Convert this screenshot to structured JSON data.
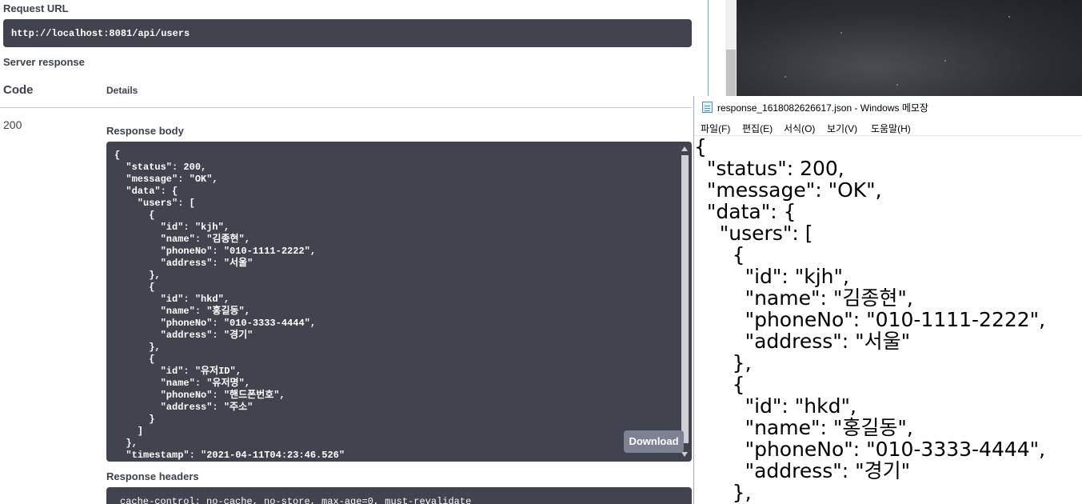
{
  "swagger": {
    "request_url_label": "Request URL",
    "request_url": "http://localhost:8081/api/users",
    "server_response_label": "Server response",
    "code_header": "Code",
    "details_header": "Details",
    "status_code": "200",
    "response_body_label": "Response body",
    "response_body_text": "{\n  \"status\": 200,\n  \"message\": \"OK\",\n  \"data\": {\n    \"users\": [\n      {\n        \"id\": \"kjh\",\n        \"name\": \"김종현\",\n        \"phoneNo\": \"010-1111-2222\",\n        \"address\": \"서울\"\n      },\n      {\n        \"id\": \"hkd\",\n        \"name\": \"홍길동\",\n        \"phoneNo\": \"010-3333-4444\",\n        \"address\": \"경기\"\n      },\n      {\n        \"id\": \"유저ID\",\n        \"name\": \"유저명\",\n        \"phoneNo\": \"핸드폰번호\",\n        \"address\": \"주소\"\n      }\n    ]\n  },\n  \"timestamp\": \"2021-04-11T04:23:46.526\"",
    "download_label": "Download",
    "response_headers_label": "Response headers",
    "response_headers_text": "cache-control: no-cache, no-store, max-age=0, must-revalidate"
  },
  "notepad": {
    "title": "response_1618082626617.json - Windows 메모장",
    "menu": [
      "파일(F)",
      "편집(E)",
      "서식(O)",
      "보기(V)",
      "도움말(H)"
    ],
    "content": "{\n  \"status\": 200,\n  \"message\": \"OK\",\n  \"data\": {\n    \"users\": [\n      {\n        \"id\": \"kjh\",\n        \"name\": \"김종현\",\n        \"phoneNo\": \"010-1111-2222\",\n        \"address\": \"서울\"\n      },\n      {\n        \"id\": \"hkd\",\n        \"name\": \"홍길동\",\n        \"phoneNo\": \"010-3333-4444\",\n        \"address\": \"경기\"\n      },"
  },
  "colors": {
    "code_block_bg": "#41444e",
    "download_button_bg": "#7d8293",
    "accent_line": "#61affe",
    "heading_text": "#3b4151"
  },
  "icons": {
    "notepad_app": "notepad-icon"
  }
}
